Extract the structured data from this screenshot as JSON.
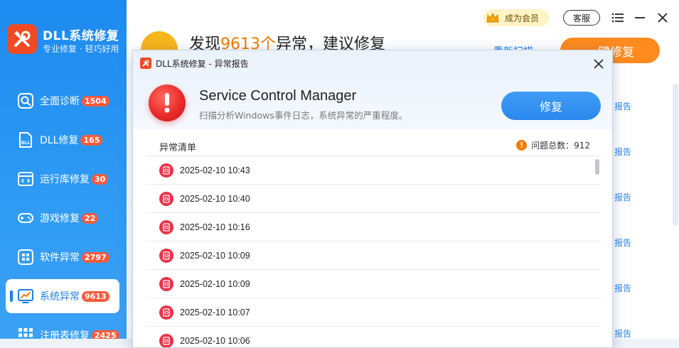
{
  "app": {
    "title": "DLL系统修复",
    "subtitle": "专业修复 · 轻巧好用"
  },
  "sidebar": {
    "items": [
      {
        "label": "全面诊断",
        "badge": "1504",
        "icon": "search-icon"
      },
      {
        "label": "DLL修复",
        "badge": "165",
        "icon": "dll-file-icon"
      },
      {
        "label": "运行库修复",
        "badge": "30",
        "icon": "code-window-icon"
      },
      {
        "label": "游戏修复",
        "badge": "22",
        "icon": "gamepad-icon"
      },
      {
        "label": "软件异常",
        "badge": "2797",
        "icon": "apps-grid-icon"
      },
      {
        "label": "系统异常",
        "badge": "9613",
        "icon": "monitor-chart-icon",
        "active": true
      },
      {
        "label": "注册表修复",
        "badge": "2425",
        "icon": "registry-grid-icon"
      }
    ]
  },
  "topbar": {
    "vip_label": "成为会员",
    "service_label": "客服"
  },
  "background": {
    "title_prefix": "发现",
    "title_number": "9613个",
    "title_suffix": "异常，建议修复",
    "rescan_label": "重新扫描",
    "fix_all_label": "一键修复",
    "report_label": "报告"
  },
  "dialog": {
    "title": "DLL系统修复 - 异常报告",
    "service_name": "Service Control Manager",
    "description": "扫描分析Windows事件日志，系统异常的严重程度。",
    "repair_label": "修复",
    "list_label": "异常清单",
    "count_label": "问题总数：912",
    "rows": [
      "2025-02-10 10:43",
      "2025-02-10 10:40",
      "2025-02-10 10:16",
      "2025-02-10 10:09",
      "2025-02-10 10:09",
      "2025-02-10 10:07",
      "2025-02-10 10:06"
    ]
  },
  "colors": {
    "brand_blue": "#1d8af0",
    "brand_orange": "#ff8a1e",
    "alert_red": "#e8334a",
    "warning_yellow": "#f7b51c"
  }
}
